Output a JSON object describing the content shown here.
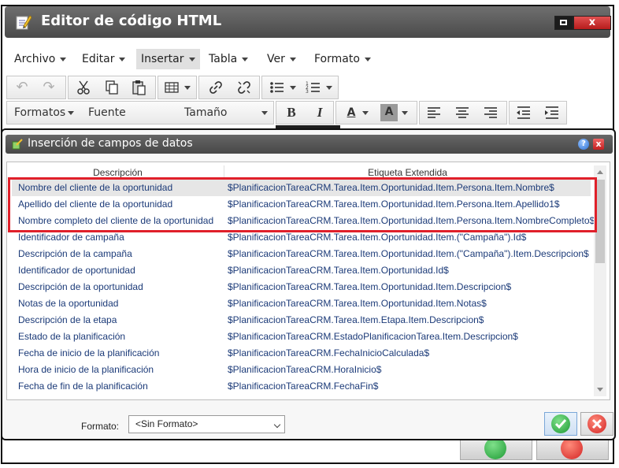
{
  "window": {
    "title": "Editor de código HTML",
    "close_label": "x"
  },
  "menu": [
    "Archivo",
    "Editar",
    "Insertar",
    "Tabla",
    "Ver",
    "Formato"
  ],
  "toolbar": {
    "undo": "↶",
    "redo": "↷",
    "formats_label": "Formatos",
    "font_label": "Fuente",
    "size_label": "Tamaño",
    "bold": "B",
    "italic": "I",
    "font_color": "A",
    "bg_color": "A"
  },
  "dialog": {
    "title": "Inserción de campos de datos",
    "help": "?",
    "close": "x",
    "columns": [
      "Descripción",
      "Etiqueta Extendida"
    ],
    "rows": [
      [
        "Nombre del cliente de la oportunidad",
        "$PlanificacionTareaCRM.Tarea.Item.Oportunidad.Item.Persona.Item.Nombre$"
      ],
      [
        "Apellido del cliente de la oportunidad",
        "$PlanificacionTareaCRM.Tarea.Item.Oportunidad.Item.Persona.Item.Apellido1$"
      ],
      [
        "Nombre completo del cliente de la oportunidad",
        "$PlanificacionTareaCRM.Tarea.Item.Oportunidad.Item.Persona.Item.NombreCompleto$"
      ],
      [
        "Identificador de campaña",
        "$PlanificacionTareaCRM.Tarea.Item.Oportunidad.Item.(\"Campaña\").Id$"
      ],
      [
        "Descripción de la campaña",
        "$PlanificacionTareaCRM.Tarea.Item.Oportunidad.Item.(\"Campaña\").Item.Descripcion$"
      ],
      [
        "Identificador de oportunidad",
        "$PlanificacionTareaCRM.Tarea.Item.Oportunidad.Id$"
      ],
      [
        "Descripción de la oportunidad",
        "$PlanificacionTareaCRM.Tarea.Item.Oportunidad.Item.Descripcion$"
      ],
      [
        "Notas de la oportunidad",
        "$PlanificacionTareaCRM.Tarea.Item.Oportunidad.Item.Notas$"
      ],
      [
        "Descripción de la etapa",
        "$PlanificacionTareaCRM.Tarea.Item.Etapa.Item.Descripcion$"
      ],
      [
        "Estado de la planificación",
        "$PlanificacionTareaCRM.EstadoPlanificacionTarea.Item.Descripcion$"
      ],
      [
        "Fecha de inicio de la planificación",
        "$PlanificacionTareaCRM.FechaInicioCalculada$"
      ],
      [
        "Hora de inicio de la planificación",
        "$PlanificacionTareaCRM.HoraInicio$"
      ],
      [
        "Fecha de fin de la planificación",
        "$PlanificacionTareaCRM.FechaFin$"
      ]
    ],
    "format_label": "Formato:",
    "format_value": "<Sin Formato>"
  },
  "colors": {
    "highlight": "#e0202a",
    "row_text": "#1b3a78"
  }
}
